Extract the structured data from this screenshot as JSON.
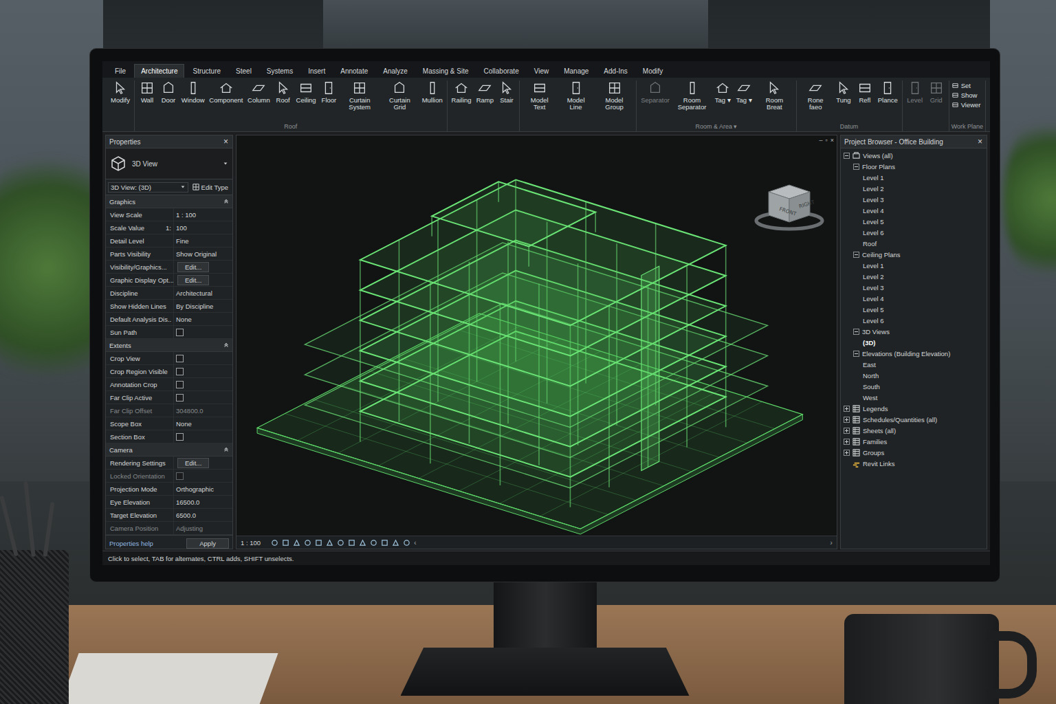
{
  "ribbon": {
    "tabs": [
      {
        "label": "File",
        "selected": false
      },
      {
        "label": "Architecture",
        "selected": true
      },
      {
        "label": "Structure",
        "selected": false
      },
      {
        "label": "Steel",
        "selected": false
      },
      {
        "label": "Systems",
        "selected": false
      },
      {
        "label": "Insert",
        "selected": false
      },
      {
        "label": "Annotate",
        "selected": false
      },
      {
        "label": "Analyze",
        "selected": false
      },
      {
        "label": "Massing & Site",
        "selected": false
      },
      {
        "label": "Collaborate",
        "selected": false
      },
      {
        "label": "View",
        "selected": false
      },
      {
        "label": "Manage",
        "selected": false
      },
      {
        "label": "Add-Ins",
        "selected": false
      },
      {
        "label": "Modify",
        "selected": false
      }
    ],
    "groups": [
      {
        "tools": [
          {
            "label": "Modify",
            "kind": "large",
            "disabled": false
          }
        ]
      },
      {
        "label": "Roof",
        "tools": [
          {
            "label": "Wall",
            "kind": "large",
            "disabled": false
          },
          {
            "label": "Door",
            "kind": "large",
            "disabled": false
          },
          {
            "label": "Window",
            "kind": "large",
            "disabled": false
          },
          {
            "label": "Component",
            "kind": "large",
            "disabled": false
          },
          {
            "label": "Column",
            "kind": "large",
            "disabled": false
          },
          {
            "label": "Roof",
            "kind": "large",
            "disabled": false
          },
          {
            "label": "Ceiling",
            "kind": "large",
            "disabled": false
          },
          {
            "label": "Floor",
            "kind": "large",
            "disabled": false
          },
          {
            "label": "Curtain System",
            "kind": "large",
            "disabled": false
          },
          {
            "label": "Curtain Grid",
            "kind": "large",
            "disabled": false
          },
          {
            "label": "Mullion",
            "kind": "large",
            "disabled": false
          }
        ]
      },
      {
        "tools": [
          {
            "label": "Railing",
            "kind": "large",
            "disabled": false
          },
          {
            "label": "Ramp",
            "kind": "large",
            "disabled": false
          },
          {
            "label": "Stair",
            "kind": "large",
            "disabled": false
          }
        ]
      },
      {
        "tools": [
          {
            "label": "Model Text",
            "kind": "large",
            "disabled": false
          },
          {
            "label": "Model Line",
            "kind": "large",
            "disabled": false
          },
          {
            "label": "Model Group",
            "kind": "large",
            "disabled": false
          }
        ]
      },
      {
        "label": "Room & Area ▾",
        "tools": [
          {
            "label": "Separator",
            "kind": "large",
            "disabled": true
          },
          {
            "label": "Room Separator",
            "kind": "large",
            "disabled": false
          },
          {
            "label": "Tag ▾",
            "kind": "large",
            "disabled": false
          },
          {
            "label": "Tag ▾",
            "kind": "large",
            "disabled": false
          },
          {
            "label": "Room Breat",
            "kind": "large",
            "disabled": false
          }
        ]
      },
      {
        "label": "Datum",
        "tools": [
          {
            "label": "Rone faeo",
            "kind": "large",
            "disabled": false
          },
          {
            "label": "Tung",
            "kind": "large",
            "disabled": false
          },
          {
            "label": "Refl",
            "kind": "large",
            "disabled": false
          },
          {
            "label": "Plance",
            "kind": "large",
            "disabled": false
          }
        ]
      },
      {
        "tools": [
          {
            "label": "Level",
            "kind": "large",
            "disabled": true
          },
          {
            "label": "Grid",
            "kind": "large",
            "disabled": true
          }
        ]
      },
      {
        "label": "Work Plane",
        "tools": [
          {
            "label": "Set",
            "kind": "small",
            "disabled": false
          },
          {
            "label": "Show",
            "kind": "small",
            "disabled": false
          },
          {
            "label": "Viewer",
            "kind": "small",
            "disabled": false
          }
        ]
      }
    ]
  },
  "properties": {
    "title": "Properties",
    "close": "×",
    "type_name": "3D View",
    "selector": "3D View: (3D)",
    "edit_type": "Edit Type",
    "sections": [
      {
        "title": "Graphics",
        "rows": [
          {
            "label": "View Scale",
            "kind": "text",
            "value": "1 : 100",
            "disabled": false
          },
          {
            "label": "Scale Value",
            "prefix": "1:",
            "kind": "text",
            "value": "100",
            "disabled": false
          },
          {
            "label": "Detail Level",
            "kind": "text",
            "value": "Fine",
            "disabled": false
          },
          {
            "label": "Parts Visibility",
            "kind": "text",
            "value": "Show Original",
            "disabled": false
          },
          {
            "label": "Visibility/Graphics...",
            "kind": "button",
            "value": "Edit...",
            "disabled": false
          },
          {
            "label": "Graphic Display Opt...",
            "kind": "button",
            "value": "Edit...",
            "disabled": false
          },
          {
            "label": "Discipline",
            "kind": "text",
            "value": "Architectural",
            "disabled": false
          },
          {
            "label": "Show Hidden Lines",
            "kind": "text",
            "value": "By Discipline",
            "disabled": false
          },
          {
            "label": "Default Analysis Dis..",
            "kind": "text",
            "value": "None",
            "disabled": false
          },
          {
            "label": "Sun Path",
            "kind": "checkbox",
            "checked": false,
            "disabled": false
          }
        ]
      },
      {
        "title": "Extents",
        "rows": [
          {
            "label": "Crop View",
            "kind": "checkbox",
            "checked": false,
            "disabled": false
          },
          {
            "label": "Crop Region Visible",
            "kind": "checkbox",
            "checked": false,
            "disabled": false
          },
          {
            "label": "Annotation Crop",
            "kind": "checkbox",
            "checked": false,
            "disabled": false
          },
          {
            "label": "Far Clip Active",
            "kind": "checkbox",
            "checked": false,
            "disabled": false
          },
          {
            "label": "Far Clip Offset",
            "kind": "text",
            "value": "304800.0",
            "disabled": true
          },
          {
            "label": "Scope Box",
            "kind": "text",
            "value": "None",
            "disabled": false
          },
          {
            "label": "Section Box",
            "kind": "checkbox",
            "checked": false,
            "disabled": false
          }
        ]
      },
      {
        "title": "Camera",
        "rows": [
          {
            "label": "Rendering Settings",
            "kind": "button",
            "value": "Edit...",
            "disabled": false
          },
          {
            "label": "Locked Orientation",
            "kind": "checkbox",
            "checked": false,
            "disabled": true
          },
          {
            "label": "Projection Mode",
            "kind": "text",
            "value": "Orthographic",
            "disabled": false
          },
          {
            "label": "Eye Elevation",
            "kind": "text",
            "value": "16500.0",
            "disabled": false
          },
          {
            "label": "Target Elevation",
            "kind": "text",
            "value": "6500.0",
            "disabled": false
          },
          {
            "label": "Camera Position",
            "kind": "text",
            "value": "Adjusting",
            "disabled": true
          }
        ]
      }
    ],
    "help": "Properties help",
    "apply": "Apply"
  },
  "viewport": {
    "window_controls": [
      "–",
      "▫",
      "×"
    ],
    "viewcube": {
      "front": "FRONT",
      "right": "RIGHT"
    },
    "scale": "1 : 100",
    "scroll_left": "‹",
    "scroll_right": "›"
  },
  "browser": {
    "title": "Project Browser - Office Building",
    "close": "×",
    "items": [
      {
        "label": "Views (all)",
        "depth": 0,
        "kind": "root",
        "expanded": true,
        "selected": false
      },
      {
        "label": "Floor Plans",
        "depth": 1,
        "kind": "branch",
        "expanded": true,
        "selected": false
      },
      {
        "label": "Level 1",
        "depth": 2,
        "kind": "leaf",
        "expanded": false,
        "selected": false
      },
      {
        "label": "Level 2",
        "depth": 2,
        "kind": "leaf",
        "expanded": false,
        "selected": false
      },
      {
        "label": "Level 3",
        "depth": 2,
        "kind": "leaf",
        "expanded": false,
        "selected": false
      },
      {
        "label": "Level 4",
        "depth": 2,
        "kind": "leaf",
        "expanded": false,
        "selected": false
      },
      {
        "label": "Level 5",
        "depth": 2,
        "kind": "leaf",
        "expanded": false,
        "selected": false
      },
      {
        "label": "Level 6",
        "depth": 2,
        "kind": "leaf",
        "expanded": false,
        "selected": false
      },
      {
        "label": "Roof",
        "depth": 2,
        "kind": "leaf",
        "expanded": false,
        "selected": false
      },
      {
        "label": "Ceiling Plans",
        "depth": 1,
        "kind": "branch",
        "expanded": true,
        "selected": false
      },
      {
        "label": "Level 1",
        "depth": 2,
        "kind": "leaf",
        "expanded": false,
        "selected": false
      },
      {
        "label": "Level 2",
        "depth": 2,
        "kind": "leaf",
        "expanded": false,
        "selected": false
      },
      {
        "label": "Level 3",
        "depth": 2,
        "kind": "leaf",
        "expanded": false,
        "selected": false
      },
      {
        "label": "Level 4",
        "depth": 2,
        "kind": "leaf",
        "expanded": false,
        "selected": false
      },
      {
        "label": "Level 5",
        "depth": 2,
        "kind": "leaf",
        "expanded": false,
        "selected": false
      },
      {
        "label": "Level 6",
        "depth": 2,
        "kind": "leaf",
        "expanded": false,
        "selected": false
      },
      {
        "label": "3D Views",
        "depth": 1,
        "kind": "branch",
        "expanded": true,
        "selected": false
      },
      {
        "label": "(3D)",
        "depth": 2,
        "kind": "leaf",
        "expanded": false,
        "selected": true
      },
      {
        "label": "Elevations (Building Elevation)",
        "depth": 1,
        "kind": "branch",
        "expanded": true,
        "selected": false
      },
      {
        "label": "East",
        "depth": 2,
        "kind": "leaf",
        "expanded": false,
        "selected": false
      },
      {
        "label": "North",
        "depth": 2,
        "kind": "leaf",
        "expanded": false,
        "selected": false
      },
      {
        "label": "South",
        "depth": 2,
        "kind": "leaf",
        "expanded": false,
        "selected": false
      },
      {
        "label": "West",
        "depth": 2,
        "kind": "leaf",
        "expanded": false,
        "selected": false
      },
      {
        "label": "Legends",
        "depth": 0,
        "kind": "category",
        "expanded": false,
        "selected": false
      },
      {
        "label": "Schedules/Quantities (all)",
        "depth": 0,
        "kind": "category",
        "expanded": false,
        "selected": false
      },
      {
        "label": "Sheets (all)",
        "depth": 0,
        "kind": "category",
        "expanded": false,
        "selected": false
      },
      {
        "label": "Families",
        "depth": 0,
        "kind": "category",
        "expanded": false,
        "selected": false
      },
      {
        "label": "Groups",
        "depth": 0,
        "kind": "category",
        "expanded": false,
        "selected": false
      },
      {
        "label": "Revit Links",
        "depth": 0,
        "kind": "links",
        "expanded": false,
        "selected": false
      }
    ]
  },
  "status_bar": "Click to select, TAB for alternates, CTRL adds, SHIFT unselects."
}
